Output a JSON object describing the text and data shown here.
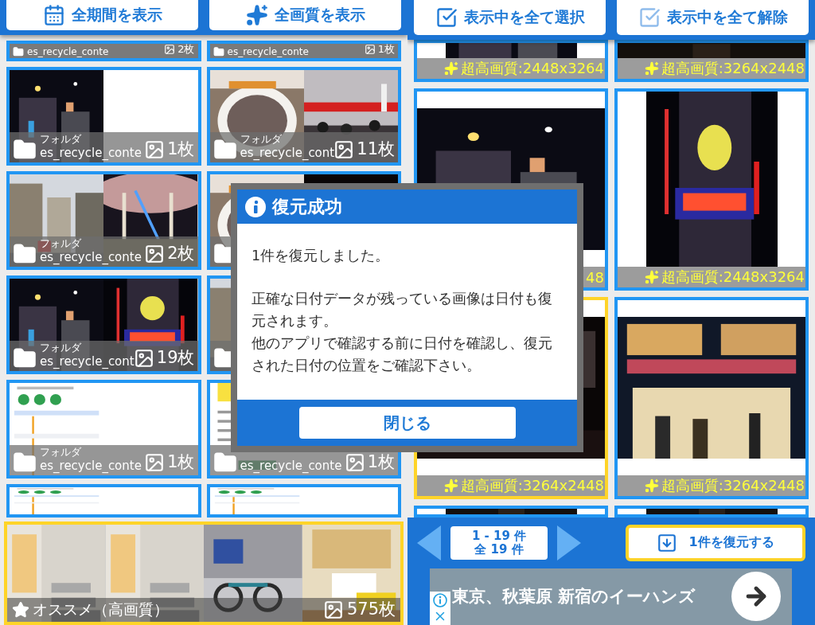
{
  "left_panel": {
    "toolbar": [
      {
        "kind": "calendar",
        "label": "全期間を表示"
      },
      {
        "kind": "sparkle",
        "label": "全画質を表示"
      }
    ],
    "rows": [
      [
        {
          "kind": "folder",
          "name": "es_recycle_conte",
          "count": "2枚"
        },
        {
          "kind": "folder",
          "name": "es_recycle_conte",
          "count": "1枚"
        }
      ],
      [
        {
          "kind": "folder",
          "label": "フォルダ",
          "name": "es_recycle_conte",
          "count": "1枚"
        },
        {
          "kind": "folder",
          "label": "フォルダ",
          "name": "es_recycle_cont",
          "count": "11枚"
        }
      ],
      [
        {
          "kind": "folder",
          "label": "フォルダ",
          "name": "es_recycle_conte",
          "count": "2枚"
        },
        {
          "kind": "folder"
        }
      ],
      [
        {
          "kind": "folder",
          "label": "フォルダ",
          "name": "es_recycle_cont",
          "count": "19枚"
        },
        {
          "kind": "folder"
        }
      ],
      [
        {
          "kind": "folder",
          "label": "フォルダ",
          "name": "es_recycle_conte",
          "count": "1枚"
        },
        {
          "kind": "folder",
          "name": "es_recycle_conte",
          "count": "1枚"
        }
      ],
      [
        {
          "kind": "cropped"
        },
        {
          "kind": "cropped"
        }
      ]
    ],
    "featured": {
      "title": "オススメ（高画質）",
      "count": "575枚"
    }
  },
  "right_panel": {
    "toolbar": [
      {
        "kind": "select",
        "label": "表示中を全て選択"
      },
      {
        "kind": "deselect",
        "label": "表示中を全て解除"
      }
    ],
    "rows": [
      [
        {
          "quality": "超高画質:2448x3264",
          "selected": false
        },
        {
          "quality": "超高画質:3264x2448",
          "selected": false
        }
      ],
      [
        {
          "quality": "48",
          "selected": false
        },
        {
          "quality": "超高画質:2448x3264",
          "selected": false
        }
      ],
      [
        {
          "quality": "超高画質:3264x2448",
          "selected": true
        },
        {
          "quality": "超高画質:3264x2448",
          "selected": false
        }
      ],
      [
        {
          "selected": false
        },
        {
          "selected": false
        }
      ]
    ],
    "pager": {
      "range": "1 - 19 件",
      "total": "全 19 件"
    },
    "restore_button": "1件を復元する",
    "ad": {
      "text": "東京、秋葉原 新宿のイーハンズ"
    }
  },
  "dialog": {
    "title": "復元成功",
    "paragraphs": [
      "1件を復元しました。",
      "正確な日付データが残っている画像は日付も復元されます。",
      "他のアプリで確認する前に日付を確認し、復元された日付の位置をご確認下さい。"
    ],
    "close_button": "閉じる"
  }
}
